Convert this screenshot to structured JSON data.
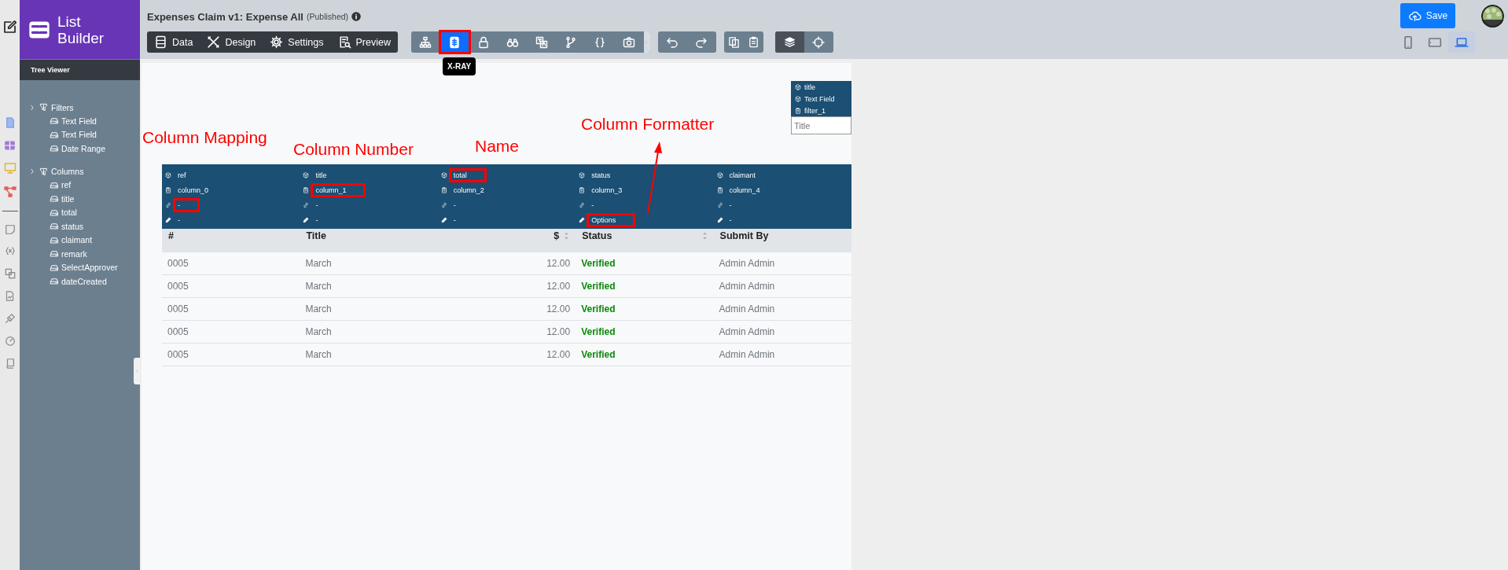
{
  "brand": {
    "line1": "List",
    "line2": "Builder"
  },
  "tree_viewer": {
    "title": "Tree Viewer",
    "groups": [
      {
        "label": "Filters",
        "children": [
          {
            "label": "Text Field"
          },
          {
            "label": "Text Field"
          },
          {
            "label": "Date Range"
          }
        ]
      },
      {
        "label": "Columns",
        "children": [
          {
            "label": "ref"
          },
          {
            "label": "title"
          },
          {
            "label": "total"
          },
          {
            "label": "status"
          },
          {
            "label": "claimant"
          },
          {
            "label": "remark"
          },
          {
            "label": "SelectApprover"
          },
          {
            "label": "dateCreated"
          }
        ]
      }
    ]
  },
  "header": {
    "title": "Expenses Claim v1: Expense All",
    "status": "(Published)"
  },
  "mode_tabs": [
    {
      "kind": "data",
      "label": "Data"
    },
    {
      "kind": "design",
      "label": "Design"
    },
    {
      "kind": "settings",
      "label": "Settings"
    },
    {
      "kind": "preview",
      "label": "Preview"
    }
  ],
  "tools": [
    {
      "kind": "tree",
      "selected": false,
      "marked": false
    },
    {
      "kind": "xray",
      "selected": true,
      "marked": true
    },
    {
      "kind": "lock",
      "selected": false,
      "marked": false
    },
    {
      "kind": "binoculars",
      "selected": false,
      "marked": false
    },
    {
      "kind": "translate",
      "selected": false,
      "marked": false
    },
    {
      "kind": "branch",
      "selected": false,
      "marked": false
    },
    {
      "kind": "braces",
      "selected": false,
      "marked": false
    },
    {
      "kind": "camera",
      "selected": false,
      "marked": false
    }
  ],
  "tooltip": "X-RAY",
  "save_button": "Save",
  "devices": [
    {
      "kind": "phone",
      "selected": false
    },
    {
      "kind": "tablet",
      "selected": false
    },
    {
      "kind": "laptop",
      "selected": true
    }
  ],
  "filter_preview": {
    "name": "title",
    "type": "Text Field",
    "id": "filter_1",
    "placeholder": "Title"
  },
  "annotations": [
    {
      "text": "Column Mapping"
    },
    {
      "text": "Column Number"
    },
    {
      "text": "Name"
    },
    {
      "text": "Column Formatter"
    }
  ],
  "table": {
    "columns": [
      {
        "kind": "text",
        "header": "#",
        "sortable": false,
        "fields": [
          {
            "kind": "name",
            "text": "ref",
            "marked": false
          },
          {
            "kind": "number",
            "text": "column_0",
            "marked": false
          },
          {
            "kind": "mapping",
            "text": "-",
            "marked": true
          },
          {
            "kind": "formatter",
            "text": "-",
            "marked": false
          }
        ]
      },
      {
        "kind": "text",
        "header": "Title",
        "sortable": false,
        "fields": [
          {
            "kind": "name",
            "text": "title",
            "marked": false
          },
          {
            "kind": "number",
            "text": "column_1",
            "marked": true
          },
          {
            "kind": "mapping",
            "text": "-",
            "marked": false
          },
          {
            "kind": "formatter",
            "text": "-",
            "marked": false
          }
        ]
      },
      {
        "kind": "amount",
        "header": "$",
        "sortable": true,
        "fields": [
          {
            "kind": "name",
            "text": "total",
            "marked": true
          },
          {
            "kind": "number",
            "text": "column_2",
            "marked": false
          },
          {
            "kind": "mapping",
            "text": "-",
            "marked": false
          },
          {
            "kind": "formatter",
            "text": "-",
            "marked": false
          }
        ]
      },
      {
        "kind": "status",
        "header": "Status",
        "sortable": true,
        "fields": [
          {
            "kind": "name",
            "text": "status",
            "marked": false
          },
          {
            "kind": "number",
            "text": "column_3",
            "marked": false
          },
          {
            "kind": "mapping",
            "text": "-",
            "marked": false
          },
          {
            "kind": "formatter",
            "text": "Options",
            "marked": true
          }
        ]
      },
      {
        "kind": "text",
        "header": "Submit By",
        "sortable": false,
        "fields": [
          {
            "kind": "name",
            "text": "claimant",
            "marked": false
          },
          {
            "kind": "number",
            "text": "column_4",
            "marked": false
          },
          {
            "kind": "mapping",
            "text": "-",
            "marked": false
          },
          {
            "kind": "formatter",
            "text": "-",
            "marked": false
          }
        ]
      }
    ],
    "rows": [
      [
        "0005",
        "March",
        "12.00",
        "Verified",
        "Admin Admin"
      ],
      [
        "0005",
        "March",
        "12.00",
        "Verified",
        "Admin Admin"
      ],
      [
        "0005",
        "March",
        "12.00",
        "Verified",
        "Admin Admin"
      ],
      [
        "0005",
        "March",
        "12.00",
        "Verified",
        "Admin Admin"
      ],
      [
        "0005",
        "March",
        "12.00",
        "Verified",
        "Admin Admin"
      ]
    ]
  }
}
